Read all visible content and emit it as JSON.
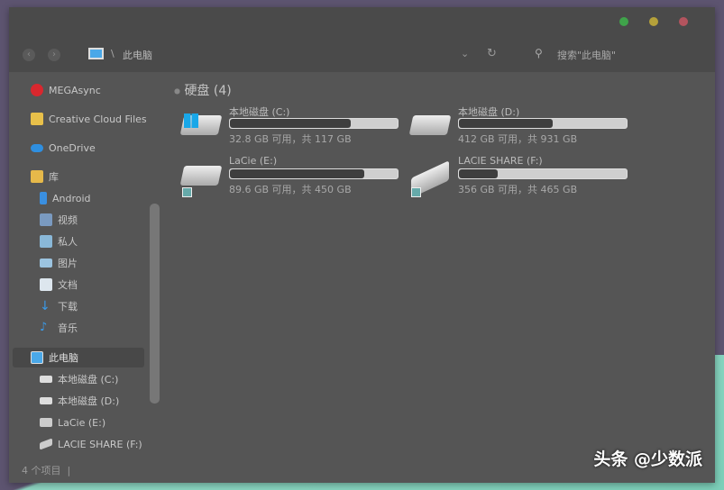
{
  "window": {
    "breadcrumb_sep": "\\",
    "location": "此电脑",
    "search_placeholder": "搜索\"此电脑\"",
    "traffic": {
      "green": "#3fa34a",
      "yellow": "#b5a13a",
      "red": "#b3545e"
    }
  },
  "sidebar": {
    "items": [
      {
        "label": "MEGAsync",
        "icon": "mega-icon"
      },
      {
        "label": "Creative Cloud Files",
        "icon": "creative-cloud-icon"
      },
      {
        "label": "OneDrive",
        "icon": "onedrive-icon"
      },
      {
        "label": "库",
        "icon": "library-icon"
      },
      {
        "label": "Android",
        "icon": "android-folder-icon"
      },
      {
        "label": "视频",
        "icon": "video-icon"
      },
      {
        "label": "私人",
        "icon": "private-icon"
      },
      {
        "label": "图片",
        "icon": "pictures-icon"
      },
      {
        "label": "文档",
        "icon": "documents-icon"
      },
      {
        "label": "下载",
        "icon": "download-icon"
      },
      {
        "label": "音乐",
        "icon": "music-icon"
      },
      {
        "label": "此电脑",
        "icon": "computer-icon"
      },
      {
        "label": "本地磁盘 (C:)",
        "icon": "drive-c-icon"
      },
      {
        "label": "本地磁盘 (D:)",
        "icon": "drive-d-icon"
      },
      {
        "label": "LaCie (E:)",
        "icon": "drive-e-icon"
      },
      {
        "label": "LACIE SHARE (F:)",
        "icon": "drive-f-icon"
      }
    ]
  },
  "main": {
    "group_title": "硬盘 (4)",
    "drives": [
      {
        "name": "本地磁盘 (C:)",
        "info": "32.8 GB 可用，共 117 GB",
        "used_fraction": 0.72
      },
      {
        "name": "本地磁盘 (D:)",
        "info": "412 GB 可用，共 931 GB",
        "used_fraction": 0.56
      },
      {
        "name": "LaCie (E:)",
        "info": "89.6 GB 可用，共 450 GB",
        "used_fraction": 0.8
      },
      {
        "name": "LACIE SHARE (F:)",
        "info": "356 GB 可用，共 465 GB",
        "used_fraction": 0.23
      }
    ]
  },
  "status": {
    "count": "4 个项目",
    "sep": "|"
  },
  "watermark": "头条 @少数派"
}
